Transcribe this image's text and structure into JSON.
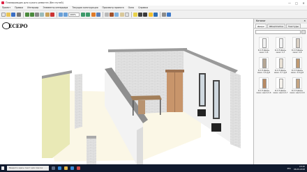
{
  "window": {
    "title": "Планировщик для сухого ремонта (без путей)",
    "controls": [
      "—",
      "□",
      "✕"
    ]
  },
  "menu": [
    "Проект",
    "Правка",
    "Интерьер",
    "Элементы интерьера",
    "Текущая конструкция",
    "Просмотр проекта",
    "Окно",
    "Справка"
  ],
  "toolbar": {
    "zoom_value": "100%"
  },
  "viewport": {
    "logo_text": "ECEPO"
  },
  "catalog": {
    "title": "Каталог",
    "close": "✕",
    "tabs": [
      "Двери",
      "Обои/плитка",
      "Текстуры"
    ],
    "items": [
      {
        "caption": "Ф-0 Л-Дверь межк. 0,6",
        "color": "#f2f2f2"
      },
      {
        "caption": "Ф-0 Л-Дверь межк. 0,7",
        "color": "#f2f2f2"
      },
      {
        "caption": "Ф-0 Л-Дверь межк. 0,8",
        "color": "#d8cfc4"
      },
      {
        "caption": "Ф-0 Л-Дверь межк. 0,6 дуб",
        "color": "#b5a694"
      },
      {
        "caption": "Ф-0 Л-Дверь межк. 0,7 дуб",
        "color": "#e9e1d6"
      },
      {
        "caption": "Ф-0 Л-Дверь межк. 0,8 дуб",
        "color": "#c09a72"
      },
      {
        "caption": "Ф-0 Л-Дверь межк. венге 0,6",
        "color": "#b88a63"
      },
      {
        "caption": "Ф-0 Л-Дверь межк. венге 0,7",
        "color": "#f4f1ec"
      },
      {
        "caption": "Ф-0 Л-Дверь межк. венге 0,8",
        "color": "#c4a482"
      }
    ]
  },
  "taskbar": {
    "search_placeholder": "Введите здесь текст для поиска",
    "language": "РУС",
    "time": "15:20",
    "date": "06.09.2018"
  }
}
